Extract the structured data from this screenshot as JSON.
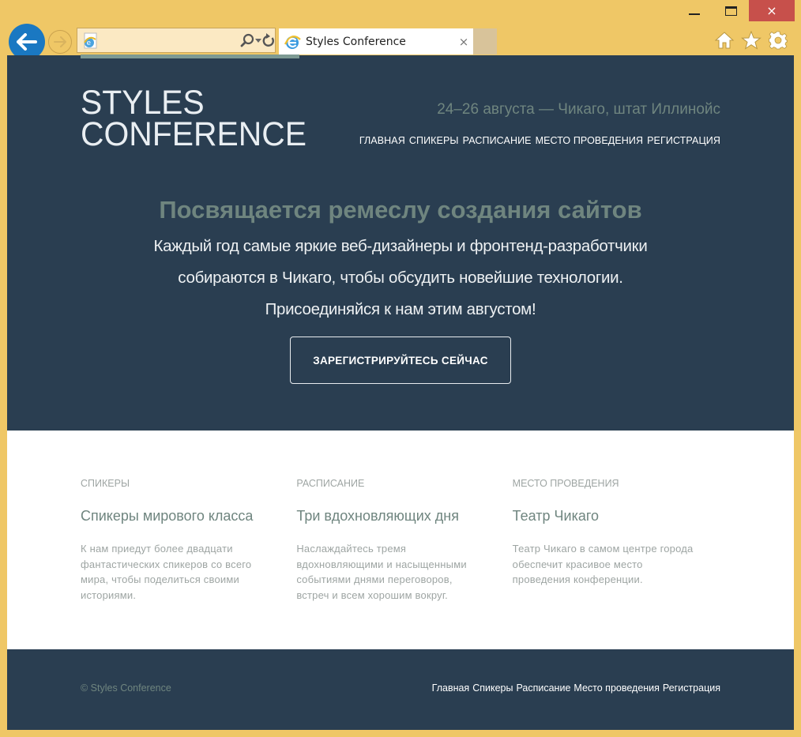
{
  "browser": {
    "window_controls": {
      "minimize": "minimize",
      "maximize": "maximize",
      "close": "×"
    },
    "address_bar": {
      "value": "",
      "placeholder": ""
    },
    "tab": {
      "title": "Styles Conference",
      "close_glyph": "×"
    },
    "toolbar_icons": [
      "home-icon",
      "star-icon",
      "gear-icon"
    ],
    "accent_color": "#efc766"
  },
  "header": {
    "logo_line1": "STYLES",
    "logo_line2": "CONFERENCE",
    "dates": "24–26 августа — Чикаго, штат Иллинойс",
    "nav": [
      "ГЛАВНАЯ",
      "СПИКЕРЫ",
      "РАСПИСАНИЕ",
      "МЕСТО ПРОВЕДЕНИЯ",
      "РЕГИСТРАЦИЯ"
    ]
  },
  "hero": {
    "tagline": "Посвящается ремеслу создания сайтов",
    "lead_lines": [
      "Каждый год самые яркие веб-дизайнеры и фронтенд-разработчики",
      "собираются в Чикаго, чтобы обсудить новейшие технологии.",
      "Присоединяйся к нам этим августом!"
    ],
    "cta_label": "ЗАРЕГИСТРИРУЙТЕСЬ СЕЙЧАС"
  },
  "features": [
    {
      "label": "СПИКЕРЫ",
      "title": "Спикеры мирового класса",
      "text": "К нам приедут более двадцати фантастических спикеров со всего мира, чтобы поделиться своими историями."
    },
    {
      "label": "РАСПИСАНИЕ",
      "title": "Три вдохновляющих дня",
      "text": "Наслаждайтесь тремя вдохновляющими и насыщенными событиями днями переговоров, встреч и всем хорошим вокруг."
    },
    {
      "label": "МЕСТО ПРОВЕДЕНИЯ",
      "title": "Театр Чикаго",
      "text": "Театр Чикаго в самом центре города обеспечит красивое место проведения конференции."
    }
  ],
  "footer": {
    "copyright": "© Styles Conference",
    "nav": [
      "Главная",
      "Спикеры",
      "Расписание",
      "Место проведения",
      "Регистрация"
    ]
  },
  "colors": {
    "dark_bg": "#2a3e51",
    "muted_green": "#6f857f",
    "muted_gray": "#9ea5a3"
  }
}
